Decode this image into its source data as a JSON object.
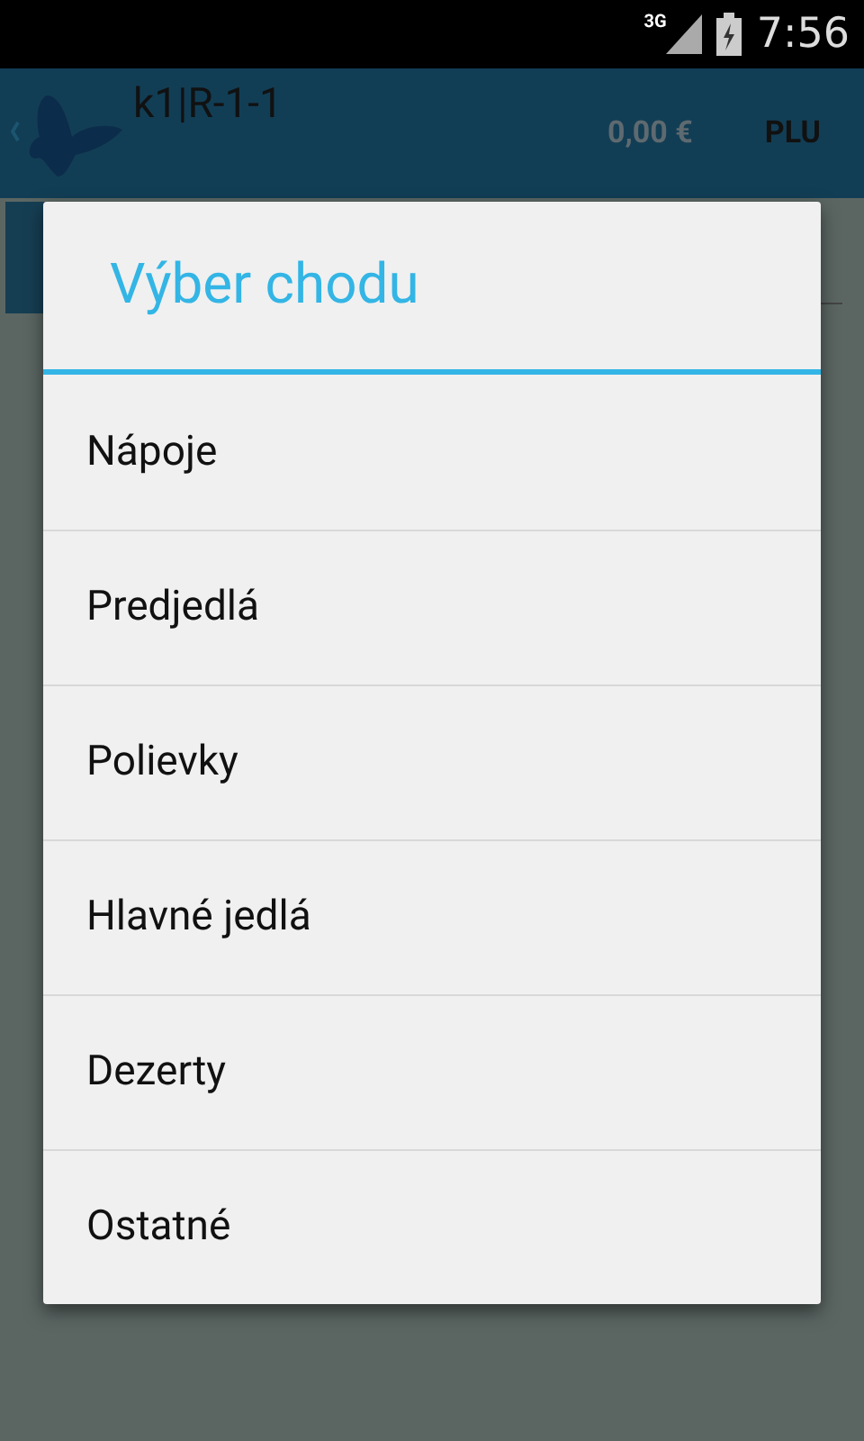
{
  "status_bar": {
    "network": "3G",
    "time": "7:56"
  },
  "action_bar": {
    "title": "k1|R-1-1",
    "total": "0,00 €",
    "plu": "PLU"
  },
  "dialog": {
    "title": "Výber chodu",
    "items": [
      {
        "label": "Nápoje"
      },
      {
        "label": "Predjedlá"
      },
      {
        "label": "Polievky"
      },
      {
        "label": "Hlavné jedlá"
      },
      {
        "label": "Dezerty"
      },
      {
        "label": "Ostatné"
      }
    ]
  }
}
